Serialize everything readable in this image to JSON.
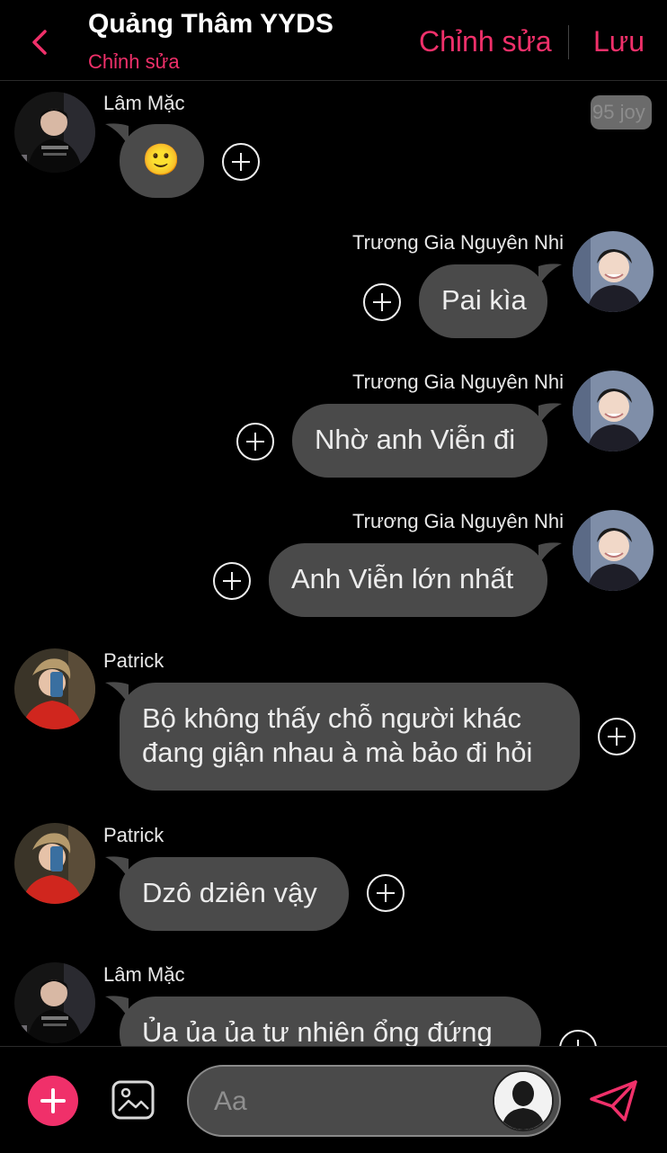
{
  "header": {
    "title": "Quảng Thâm YYDS",
    "subtitle": "Chỉnh sửa",
    "edit_label": "Chỉnh sửa",
    "save_label": "Lưu"
  },
  "badge": {
    "text": "95 joy"
  },
  "messages": [
    {
      "sender": "Lâm Mặc",
      "side": "left",
      "text": "🙂"
    },
    {
      "sender": "Trương Gia Nguyên Nhi",
      "side": "right",
      "text": "Pai kìa"
    },
    {
      "sender": "Trương Gia Nguyên Nhi",
      "side": "right",
      "text": "Nhờ anh Viễn đi"
    },
    {
      "sender": "Trương Gia Nguyên Nhi",
      "side": "right",
      "text": "Anh Viễn lớn nhất"
    },
    {
      "sender": "Patrick",
      "side": "left",
      "text_lines": [
        "Bộ không thấy chỗ người khác",
        "đang giận nhau à mà bảo đi hỏi"
      ]
    },
    {
      "sender": "Patrick",
      "side": "left",
      "text": "Dzô dziên vậy"
    },
    {
      "sender": "Lâm Mặc",
      "side": "left",
      "text": "Ủa ủa ủa tư nhiên ổng đứng"
    }
  ],
  "composer": {
    "placeholder": "Aa"
  },
  "colors": {
    "accent": "#f0306a",
    "bubble": "#4a4a4a",
    "background": "#000000"
  }
}
